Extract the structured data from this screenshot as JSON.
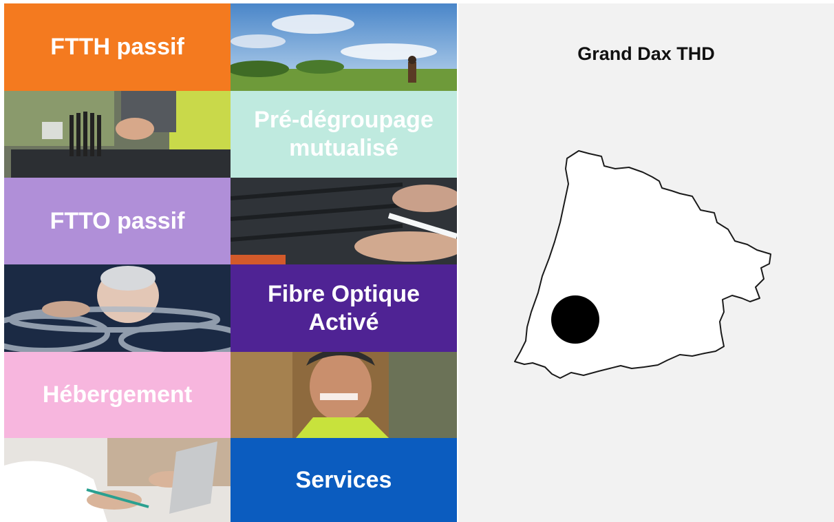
{
  "tiles": {
    "ftth": {
      "label": "FTTH passif",
      "color": "#f47a1f"
    },
    "predegroupage": {
      "label_line1": "Pré-dégroupage",
      "label_line2": "mutualisé",
      "color": "#bfeadf"
    },
    "ftto": {
      "label": "FTTO passif",
      "color": "#b08fd8"
    },
    "fibre": {
      "label_line1": "Fibre Optique",
      "label_line2": "Activé",
      "color": "#4f2394"
    },
    "hebergement": {
      "label": "Hébergement",
      "color": "#f7b6de"
    },
    "services": {
      "label": "Services",
      "color": "#0b5cbf"
    }
  },
  "photos": {
    "p1": "photo-landscape-walker",
    "p2": "photo-fiber-splicing",
    "p3": "photo-fiber-cable-hands",
    "p4": "photo-woman-fiber-coils",
    "p5": "photo-smiling-technician",
    "p6": "photo-laptop-writing"
  },
  "panel": {
    "title": "Grand Dax THD",
    "map_fill": "#ffffff",
    "marker_color": "#000000"
  }
}
